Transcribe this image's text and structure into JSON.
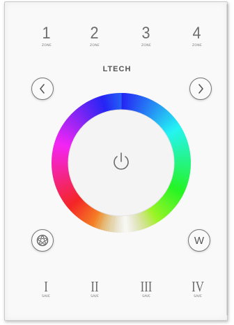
{
  "brand": "LTECH",
  "zones": [
    {
      "num": "1",
      "label": "ZONE"
    },
    {
      "num": "2",
      "label": "ZONE"
    },
    {
      "num": "3",
      "label": "ZONE"
    },
    {
      "num": "4",
      "label": "ZONE"
    }
  ],
  "saves": [
    {
      "num": "I",
      "label": "SAVE"
    },
    {
      "num": "II",
      "label": "SAVE"
    },
    {
      "num": "III",
      "label": "SAVE"
    },
    {
      "num": "IV",
      "label": "SAVE"
    }
  ],
  "buttons": {
    "prev_icon": "chevron-left-icon",
    "next_icon": "chevron-right-icon",
    "mode_icon": "film-reel-icon",
    "white_label": "W",
    "power_icon": "power-icon"
  },
  "colors": {
    "panel": "#f9f9f9",
    "text": "#6e6e6e"
  }
}
